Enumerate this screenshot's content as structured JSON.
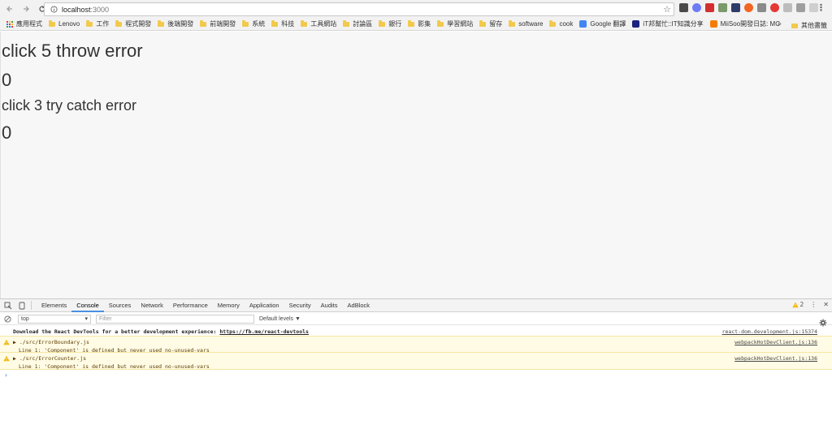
{
  "browser": {
    "url_host": "localhost",
    "url_port": ":3000",
    "bookmarks": [
      {
        "label": "應用程式",
        "kind": "apps"
      },
      {
        "label": "Lenovo",
        "kind": "folder"
      },
      {
        "label": "工作",
        "kind": "folder"
      },
      {
        "label": "程式開發",
        "kind": "folder"
      },
      {
        "label": "後端開發",
        "kind": "folder"
      },
      {
        "label": "前端開發",
        "kind": "folder"
      },
      {
        "label": "系統",
        "kind": "folder"
      },
      {
        "label": "科技",
        "kind": "folder"
      },
      {
        "label": "工具網站",
        "kind": "folder"
      },
      {
        "label": "討論區",
        "kind": "folder"
      },
      {
        "label": "銀行",
        "kind": "folder"
      },
      {
        "label": "影集",
        "kind": "folder"
      },
      {
        "label": "學習網站",
        "kind": "folder"
      },
      {
        "label": "留存",
        "kind": "folder"
      },
      {
        "label": "software",
        "kind": "folder"
      },
      {
        "label": "cook",
        "kind": "folder"
      },
      {
        "label": "Google 翻譯",
        "kind": "google"
      },
      {
        "label": "iT邦幫忙::IT知識分享",
        "kind": "ithome"
      },
      {
        "label": "MiiSoo開發日誌: MC",
        "kind": "blogger"
      }
    ],
    "more_label": "»",
    "other_bookmarks": "其他書籤"
  },
  "page": {
    "heading1": "click 5 throw error",
    "count1": "0",
    "heading2": "click 3 try catch error",
    "count2": "0"
  },
  "devtools": {
    "tabs": [
      "Elements",
      "Console",
      "Sources",
      "Network",
      "Performance",
      "Memory",
      "Application",
      "Security",
      "Audits",
      "AdBlock"
    ],
    "active_tab": "Console",
    "warning_count": "2",
    "context": "top",
    "filter_placeholder": "Filter",
    "levels": "Default levels ▼",
    "messages": {
      "info_text": "Download the React DevTools for a better development experience: ",
      "info_link": "https://fb.me/react-devtools",
      "info_source": "react-dom.development.js:15374",
      "warn1_file": "./src/ErrorBoundary.js",
      "warn1_detail": "Line 1:  'Component' is defined but never used  no-unused-vars",
      "warn1_source": "webpackHotDevClient.js:136",
      "warn2_file": "./src/ErrorCounter.js",
      "warn2_detail": "Line 1:  'Component' is defined but never used  no-unused-vars",
      "warn2_source": "webpackHotDevClient.js:136"
    },
    "prompt_symbol": "›"
  },
  "colors": {
    "page_bg": "#f7f7f7",
    "warn_bg": "#fffbe5",
    "active_tab_underline": "#4a90e2",
    "folder": "#f2c94c"
  }
}
